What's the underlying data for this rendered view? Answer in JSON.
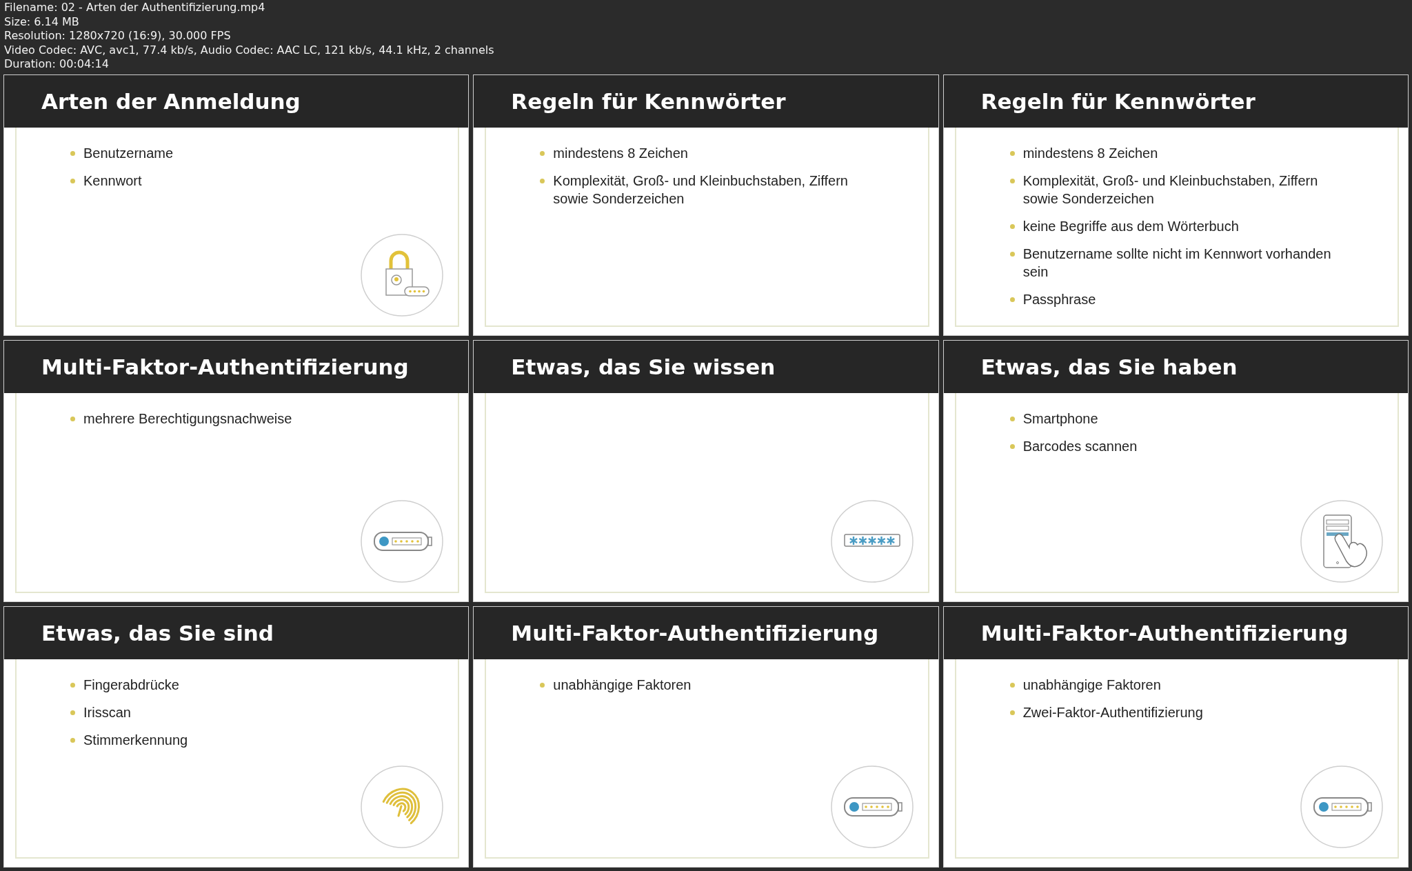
{
  "info_lines": [
    "Filename: 02 - Arten der Authentifizierung.mp4",
    "Size: 6.14 MB",
    "Resolution: 1280x720 (16:9), 30.000 FPS",
    "Video Codec: AVC, avc1, 77.4 kb/s, Audio Codec: AAC LC, 121 kb/s, 44.1 kHz, 2 channels",
    "Duration: 00:04:14"
  ],
  "slides": [
    {
      "title": "Arten der Anmeldung",
      "bullets": [
        "Benutzername",
        "Kennwort"
      ],
      "kind": "lock"
    },
    {
      "title": "Regeln für Kennwörter",
      "bullets": [
        "mindestens 8 Zeichen",
        "Komplexität, Groß- und Kleinbuchstaben, Ziffern sowie Sonderzeichen"
      ]
    },
    {
      "title": "Regeln für Kennwörter",
      "bullets": [
        "mindestens 8 Zeichen",
        "Komplexität, Groß- und Kleinbuchstaben, Ziffern sowie Sonderzeichen",
        "keine Begriffe aus dem Wörterbuch",
        "Benutzername sollte nicht im Kennwort vorhanden sein",
        "Passphrase"
      ]
    },
    {
      "title": "Multi-Faktor-Authentifizierung",
      "bullets": [
        "mehrere Berechtigungsnachweise"
      ],
      "kind": "token"
    },
    {
      "title": "Etwas, das Sie wissen",
      "kind": "password"
    },
    {
      "title": "Etwas, das Sie haben",
      "bullets": [
        "Smartphone",
        "Barcodes scannen"
      ],
      "kind": "phone"
    },
    {
      "title": "Etwas, das Sie sind",
      "bullets": [
        "Fingerabdrücke",
        "Irisscan",
        "Stimmerkennung"
      ],
      "kind": "fingerprint"
    },
    {
      "title": "Multi-Faktor-Authentifizierung",
      "bullets": [
        "unabhängige Faktoren"
      ],
      "kind": "token"
    },
    {
      "title": "Multi-Faktor-Authentifizierung",
      "bullets": [
        "unabhängige Faktoren",
        "Zwei-Faktor-Authentifizierung"
      ],
      "kind": "token"
    }
  ]
}
